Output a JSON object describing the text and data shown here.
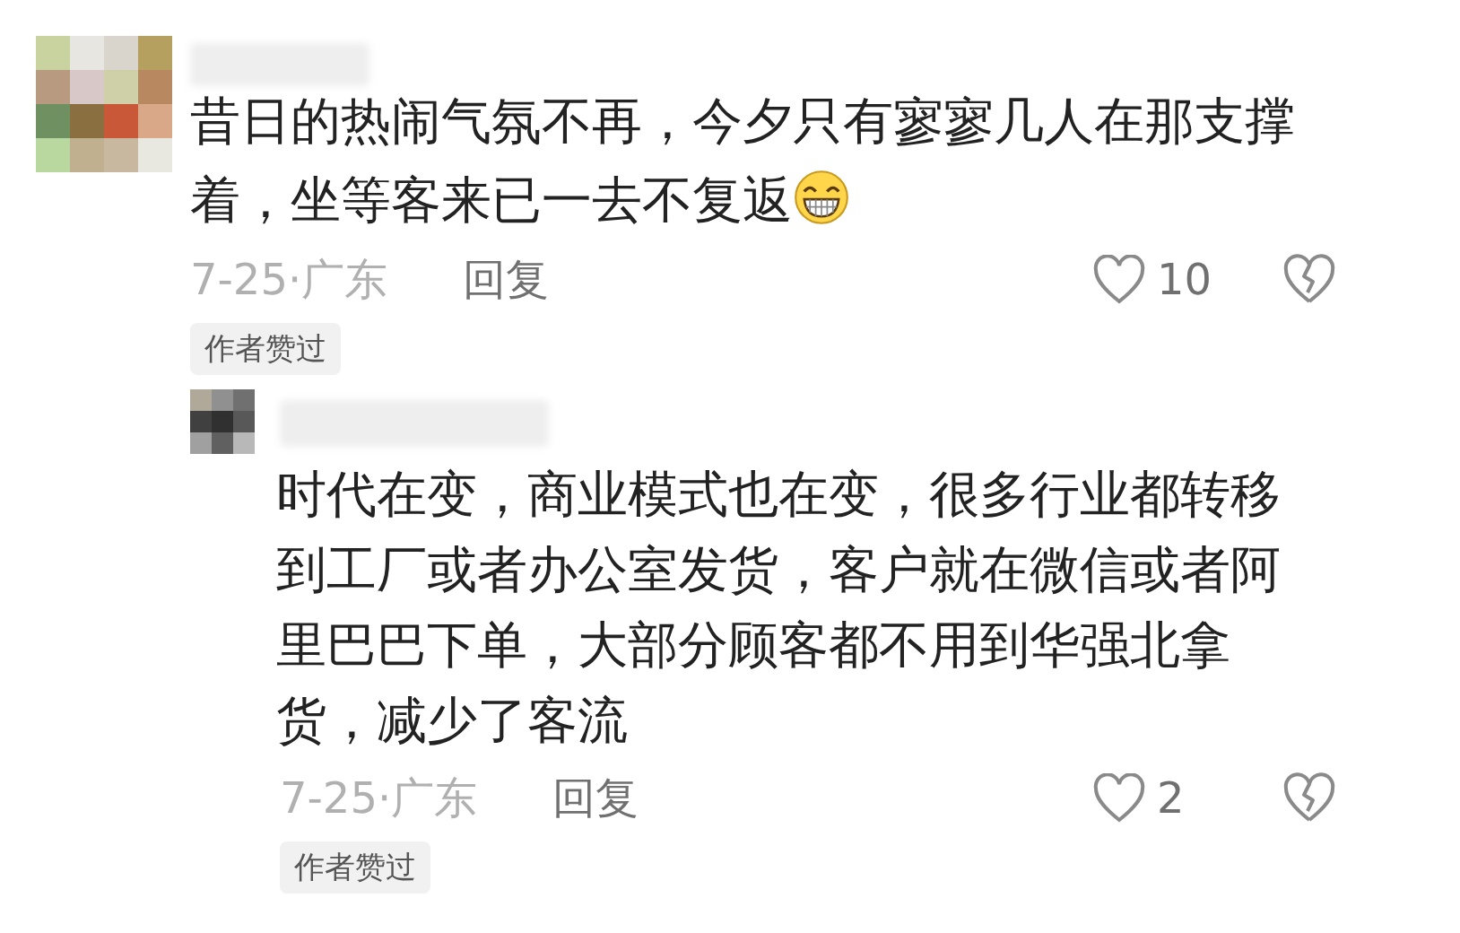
{
  "comments": [
    {
      "text": "昔日的热闹气氛不再，今夕只有寥寥几人在那支撑着，坐等客来已一去不复返",
      "emoji": true,
      "date_location": "7-25·广东",
      "reply_label": "回复",
      "like_count": "10",
      "badge": "作者赞过",
      "replies": [
        {
          "text": "时代在变，商业模式也在变，很多行业都转移到工厂或者办公室发货，客户就在微信或者阿里巴巴下单，大部分顾客都不用到华强北拿货，减少了客流",
          "emoji": false,
          "date_location": "7-25·广东",
          "reply_label": "回复",
          "like_count": "2",
          "badge": "作者赞过"
        }
      ]
    }
  ]
}
